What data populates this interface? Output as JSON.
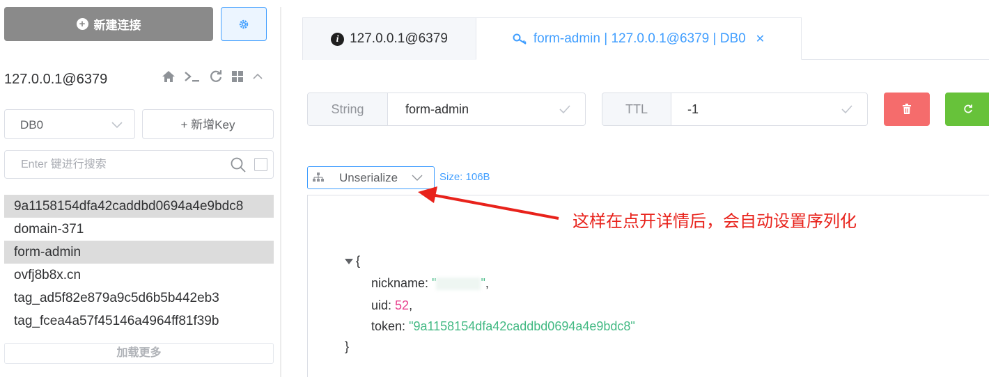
{
  "sidebar": {
    "new_connection_label": "新建连接",
    "connection_name": "127.0.0.1@6379",
    "db_select_value": "DB0",
    "add_key_label": "+ 新增Key",
    "search_placeholder": "Enter 键进行搜索",
    "keys": [
      {
        "label": "9a1158154dfa42caddbd0694a4e9bdc8",
        "highlighted": true
      },
      {
        "label": "domain-371",
        "highlighted": false
      },
      {
        "label": "form-admin",
        "highlighted": true
      },
      {
        "label": "ovfj8b8x.cn",
        "highlighted": false
      },
      {
        "label": "tag_ad5f82e879a9c5d6b5b442eb3",
        "highlighted": false
      },
      {
        "label": "tag_fcea4a57f45146a4964ff81f39b",
        "highlighted": false
      }
    ],
    "load_more_label": "加载更多"
  },
  "tabs": {
    "connection_tab": "127.0.0.1@6379",
    "key_tab": "form-admin | 127.0.0.1@6379 | DB0"
  },
  "key_info": {
    "type": "String",
    "name": "form-admin",
    "ttl_label": "TTL",
    "ttl_value": "-1"
  },
  "viewer": {
    "format": "Unserialize",
    "size": "Size: 106B",
    "json": {
      "nickname_key": "nickname",
      "nickname_value_prefix": "\"",
      "nickname_value_suffix": "\"",
      "uid_key": "uid",
      "uid_value": "52",
      "token_key": "token",
      "token_value": "\"9a1158154dfa42caddbd0694a4e9bdc8\""
    }
  },
  "annotation": {
    "text": "这样在点开详情后，会自动设置序列化",
    "color": "#e8221b"
  },
  "colors": {
    "primary": "#409eff",
    "danger": "#f56c6c",
    "success": "#67c23a",
    "json_string": "#42b983",
    "json_number": "#e83e8c"
  }
}
